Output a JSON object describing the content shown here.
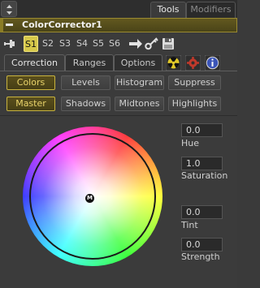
{
  "top_tabs": {
    "tools": "Tools",
    "modifiers": "Modifiers"
  },
  "tool": {
    "name": "ColorCorrector1"
  },
  "slots": [
    "S1",
    "S2",
    "S3",
    "S4",
    "S5",
    "S6"
  ],
  "active_slot": "S1",
  "page_tabs": [
    "Correction",
    "Ranges",
    "Options"
  ],
  "active_page_tab": "Correction",
  "channel_buttons": [
    "Colors",
    "Levels",
    "Histogram",
    "Suppress"
  ],
  "active_channel_button": "Colors",
  "range_buttons": [
    "Master",
    "Shadows",
    "Midtones",
    "Highlights"
  ],
  "active_range_button": "Master",
  "wheel": {
    "marker_label": "M"
  },
  "fields": {
    "hue": {
      "label": "Hue",
      "value": "0.0"
    },
    "saturation": {
      "label": "Saturation",
      "value": "1.0"
    },
    "tint": {
      "label": "Tint",
      "value": "0.0"
    },
    "strength": {
      "label": "Strength",
      "value": "0.0"
    }
  },
  "colors": {
    "accent_yellow": "#d6c84a",
    "header_bg": "#5a501e",
    "panel_bg": "#3b3b3b"
  },
  "icons": {
    "scroll": "up-down-arrows-icon",
    "pin": "pin-icon",
    "arrow": "arrow-right-icon",
    "key": "key-icon",
    "save": "save-disk-icon",
    "radioactive": "radioactive-icon",
    "gear": "gear-icon",
    "info": "info-icon"
  }
}
